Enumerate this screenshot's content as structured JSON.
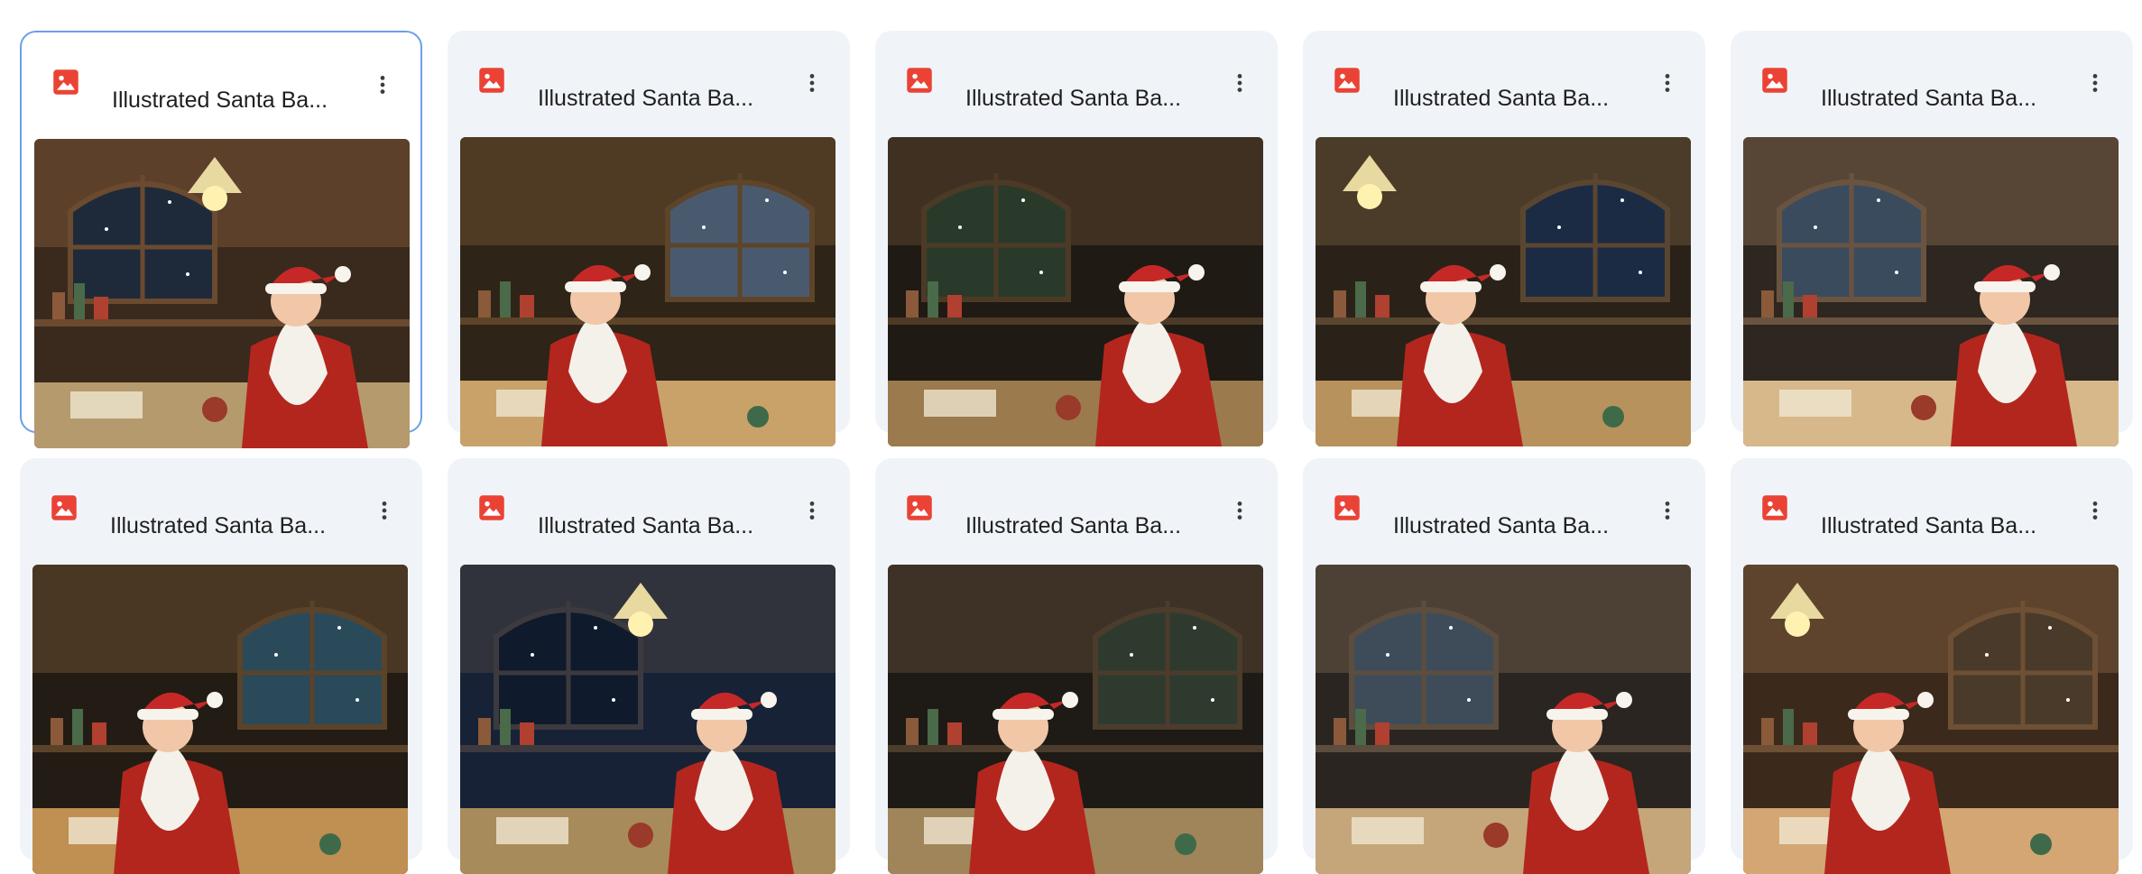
{
  "files": [
    {
      "name": "Illustrated Santa Ba...",
      "selected": true,
      "variant": 0
    },
    {
      "name": "Illustrated Santa Ba...",
      "selected": false,
      "variant": 1
    },
    {
      "name": "Illustrated Santa Ba...",
      "selected": false,
      "variant": 2
    },
    {
      "name": "Illustrated Santa Ba...",
      "selected": false,
      "variant": 3
    },
    {
      "name": "Illustrated Santa Ba...",
      "selected": false,
      "variant": 4
    },
    {
      "name": "Illustrated Santa Ba...",
      "selected": false,
      "variant": 5
    },
    {
      "name": "Illustrated Santa Ba...",
      "selected": false,
      "variant": 6
    },
    {
      "name": "Illustrated Santa Ba...",
      "selected": false,
      "variant": 7
    },
    {
      "name": "Illustrated Santa Ba...",
      "selected": false,
      "variant": 8
    },
    {
      "name": "Illustrated Santa Ba...",
      "selected": false,
      "variant": 9
    }
  ],
  "icons": {
    "file_type": "image-file-icon",
    "more": "more-vert-icon"
  },
  "colors": {
    "image_icon": "#ea4335",
    "card_bg": "#f0f4f9",
    "selected_border": "#6d9eeb",
    "text": "#1f1f1f"
  }
}
